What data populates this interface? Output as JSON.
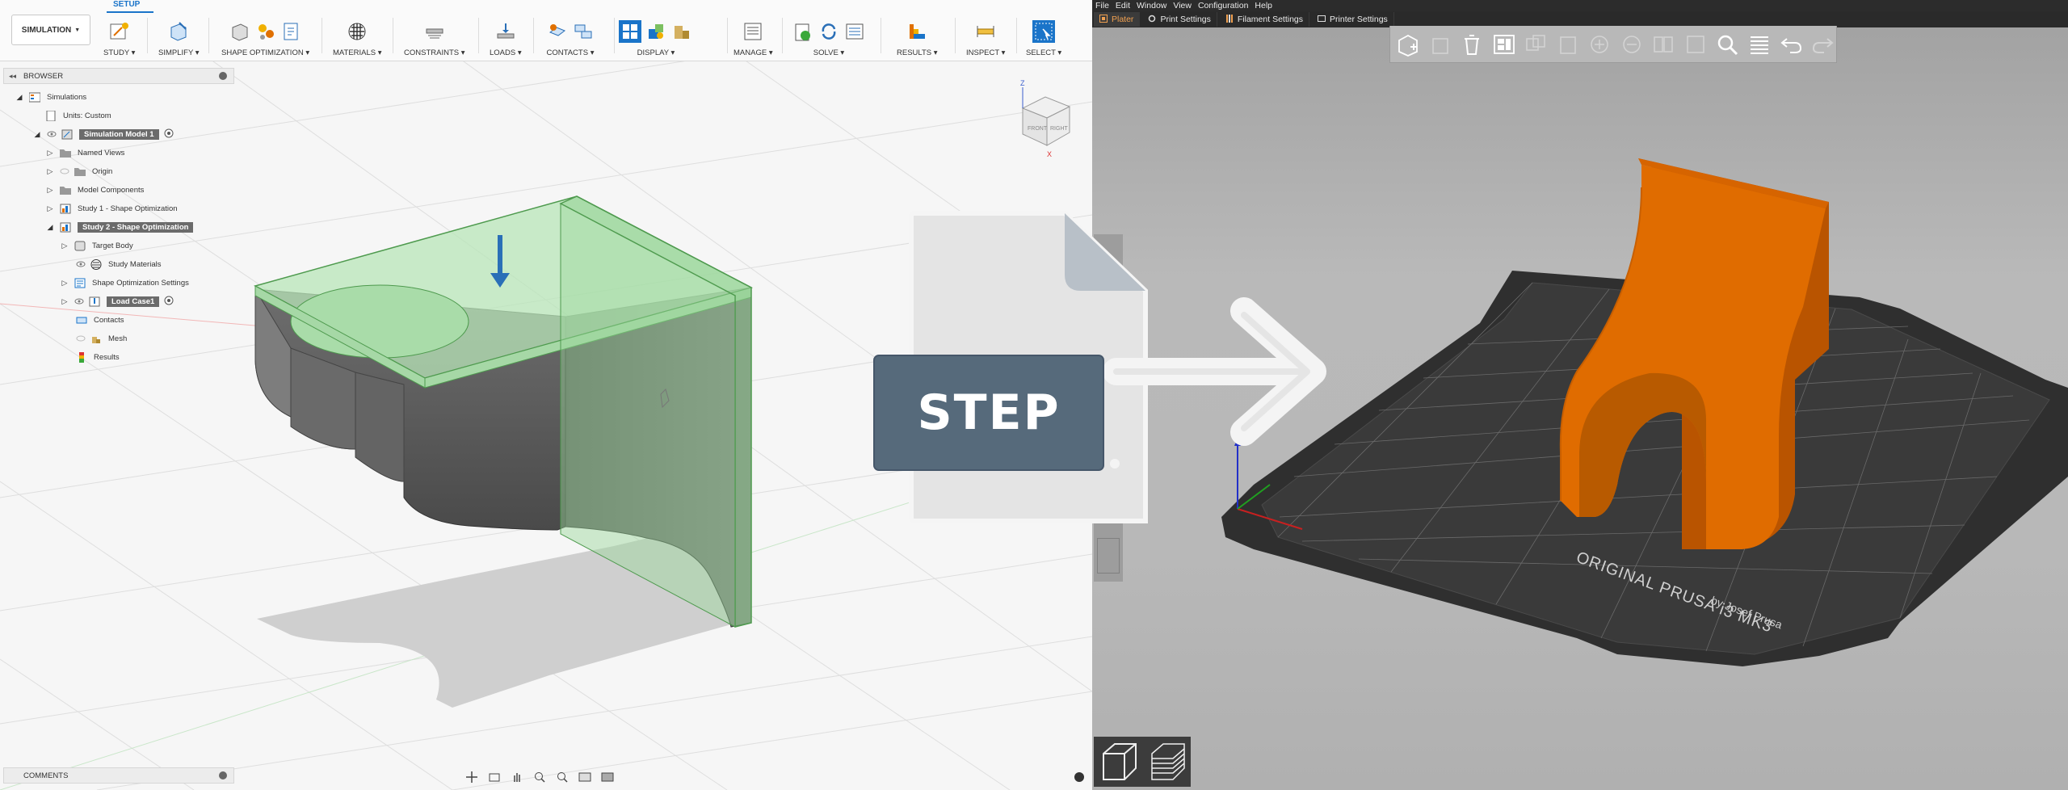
{
  "fusion": {
    "workspace_button": "SIMULATION",
    "active_tab": "SETUP",
    "toolbar_groups": [
      "STUDY",
      "SIMPLIFY",
      "SHAPE OPTIMIZATION",
      "MATERIALS",
      "CONSTRAINTS",
      "LOADS",
      "CONTACTS",
      "DISPLAY",
      "MANAGE",
      "SOLVE",
      "RESULTS",
      "INSPECT",
      "SELECT"
    ],
    "browser_title": "BROWSER",
    "comments_title": "COMMENTS",
    "tree": [
      {
        "label": "Simulations"
      },
      {
        "label": "Units: Custom"
      },
      {
        "label": "Simulation Model 1"
      },
      {
        "label": "Named Views"
      },
      {
        "label": "Origin"
      },
      {
        "label": "Model Components"
      },
      {
        "label": "Study 1 - Shape Optimization"
      },
      {
        "label": "Study 2 - Shape Optimization"
      },
      {
        "label": "Target Body"
      },
      {
        "label": "Study Materials"
      },
      {
        "label": "Shape Optimization Settings"
      },
      {
        "label": "Load Case1"
      },
      {
        "label": "Contacts"
      },
      {
        "label": "Mesh"
      },
      {
        "label": "Results"
      }
    ],
    "viewcube": {
      "face_front": "FRONT",
      "face_right": "RIGHT",
      "axis_z": "Z",
      "axis_x": "X"
    }
  },
  "step_icon": {
    "label": "STEP"
  },
  "prusa": {
    "menu": [
      "File",
      "Edit",
      "Window",
      "View",
      "Configuration",
      "Help"
    ],
    "tabs": [
      {
        "label": "Plater",
        "active": true
      },
      {
        "label": "Print Settings",
        "active": false
      },
      {
        "label": "Filament Settings",
        "active": false
      },
      {
        "label": "Printer Settings",
        "active": false
      }
    ],
    "bed_line1": "ORIGINAL PRUSA i3 MK3",
    "bed_line2": "by Josef Prusa",
    "model_color": "#e06c00",
    "bed_color": "#2f2f2f"
  },
  "colors": {
    "fusion_accent": "#1a74c9",
    "body_green": "#8fcf8f",
    "prusa_orange": "#f0a050"
  }
}
